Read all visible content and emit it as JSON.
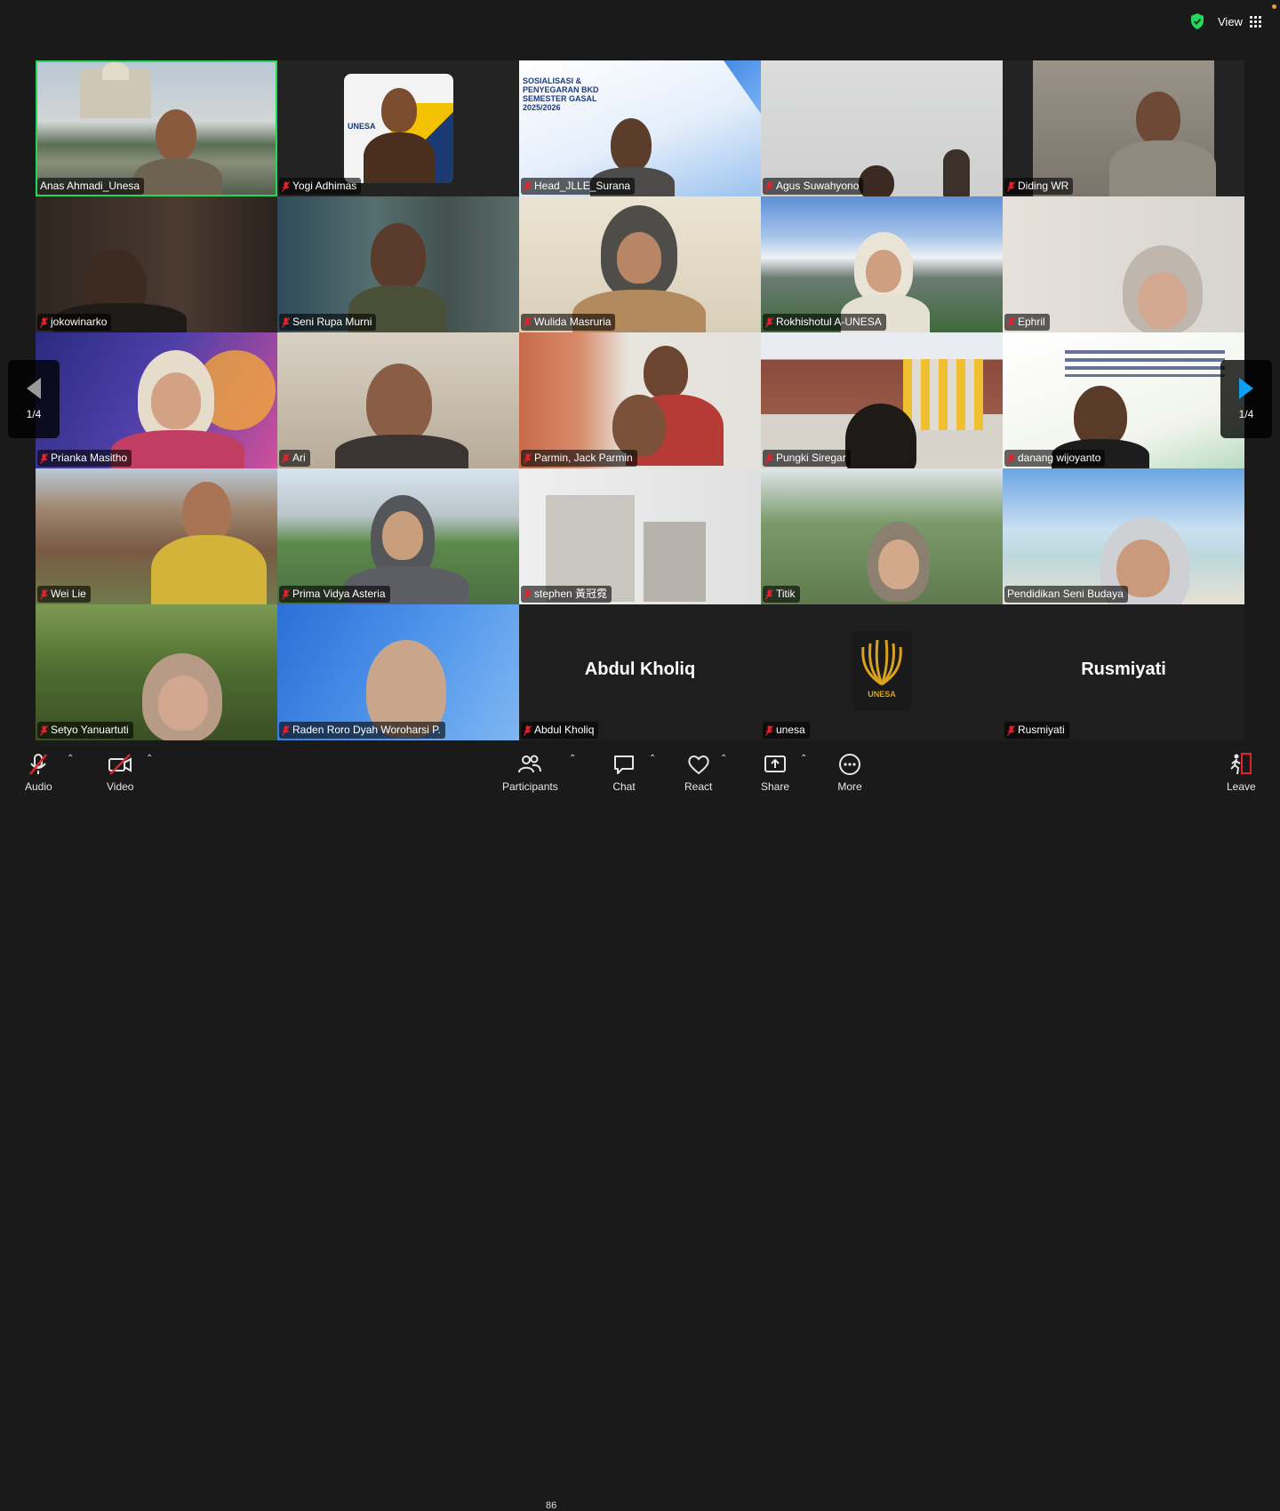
{
  "top": {
    "view_label": "View"
  },
  "gallery": {
    "page_indicator_left": "1/4",
    "page_indicator_right": "1/4",
    "tiles": [
      {
        "name": "Anas Ahmadi_Unesa",
        "muted": false,
        "active": true
      },
      {
        "name": "Yogi Adhimas",
        "muted": true,
        "badge": "UNESA"
      },
      {
        "name": "Head_JLLE_Surana",
        "muted": true,
        "slide_title": "SOSIALISASI & PENYEGARAN BKD SEMESTER GASAL 2025/2026"
      },
      {
        "name": "Agus Suwahyono",
        "muted": true
      },
      {
        "name": "Diding WR",
        "muted": true
      },
      {
        "name": "jokowinarko",
        "muted": true
      },
      {
        "name": "Seni Rupa Murni",
        "muted": true
      },
      {
        "name": "Wulida Masruria",
        "muted": true
      },
      {
        "name": "Rokhishotul A-UNESA",
        "muted": true
      },
      {
        "name": "Ephril",
        "muted": true
      },
      {
        "name": "Prianka Masitho",
        "muted": true
      },
      {
        "name": "Ari",
        "muted": true
      },
      {
        "name": "Parmin, Jack Parmin",
        "muted": true
      },
      {
        "name": "Pungki Siregar",
        "muted": true
      },
      {
        "name": "danang wijoyanto",
        "muted": true
      },
      {
        "name": "Wei Lie",
        "muted": true
      },
      {
        "name": "Prima Vidya Asteria",
        "muted": true
      },
      {
        "name": "stephen 黃冠霓",
        "muted": true
      },
      {
        "name": "Titik",
        "muted": true
      },
      {
        "name": "Pendidikan Seni Budaya",
        "muted": false
      },
      {
        "name": "Setyo Yanuartuti",
        "muted": true
      },
      {
        "name": "Raden Roro Dyah Woroharsi P.",
        "muted": true
      },
      {
        "name": "Abdul Kholiq",
        "muted": true,
        "video_off": true,
        "display_name": "Abdul Kholiq"
      },
      {
        "name": "unesa",
        "muted": true,
        "video_off": true,
        "logo_text": "UNESA"
      },
      {
        "name": "Rusmiyati",
        "muted": true,
        "video_off": true,
        "display_name": "Rusmiyati"
      }
    ]
  },
  "toolbar": {
    "audio": "Audio",
    "video": "Video",
    "participants": "Participants",
    "participants_count": "86",
    "chat": "Chat",
    "react": "React",
    "share": "Share",
    "more": "More",
    "leave": "Leave"
  },
  "colors": {
    "active_speaker": "#23d959",
    "muted_icon": "#e0242f",
    "accent_arrow": "#0e9ff2"
  }
}
